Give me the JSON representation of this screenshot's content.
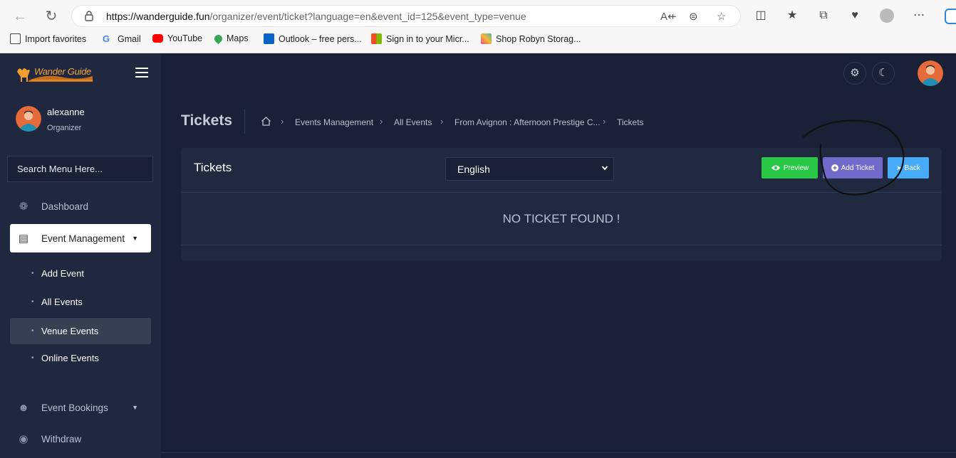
{
  "browser": {
    "url_host": "https://wanderguide.fun",
    "url_path": "/organizer/event/ticket?language=en&event_id=125&event_type=venue",
    "bookmarks": [
      {
        "label": "Import favorites"
      },
      {
        "label": "Gmail"
      },
      {
        "label": "YouTube"
      },
      {
        "label": "Maps"
      },
      {
        "label": "Outlook – free pers..."
      },
      {
        "label": "Sign in to your Micr..."
      },
      {
        "label": "Shop Robyn Storag..."
      }
    ]
  },
  "app": {
    "logo_text": "Wander Guide",
    "accent_color": "#716aca"
  },
  "user": {
    "name": "alexanne",
    "role": "Organizer"
  },
  "sidebar": {
    "search_placeholder": "Search Menu Here...",
    "items": [
      {
        "label": "Dashboard",
        "icon": "palette-icon"
      },
      {
        "label": "Event Management",
        "icon": "book-icon",
        "active": true
      },
      {
        "label": "Event Bookings",
        "icon": "people-icon"
      },
      {
        "label": "Withdraw",
        "icon": "money-icon"
      }
    ],
    "sub_items": [
      {
        "label": "Add Event"
      },
      {
        "label": "All Events"
      },
      {
        "label": "Venue Events",
        "active": true
      },
      {
        "label": "Online Events"
      }
    ]
  },
  "page": {
    "title": "Tickets",
    "breadcrumb": [
      "Events Management",
      "All Events",
      "From Avignon : Afternoon Prestige C...",
      "Tickets"
    ]
  },
  "card": {
    "title": "Tickets",
    "language_selected": "English",
    "buttons": {
      "preview": "Preview",
      "add_ticket": "Add Ticket",
      "back": "Back"
    },
    "empty_message": "NO TICKET FOUND !"
  },
  "colors": {
    "preview_button": "#28c745",
    "add_ticket_button": "#716aca",
    "back_button": "#48abf7"
  }
}
